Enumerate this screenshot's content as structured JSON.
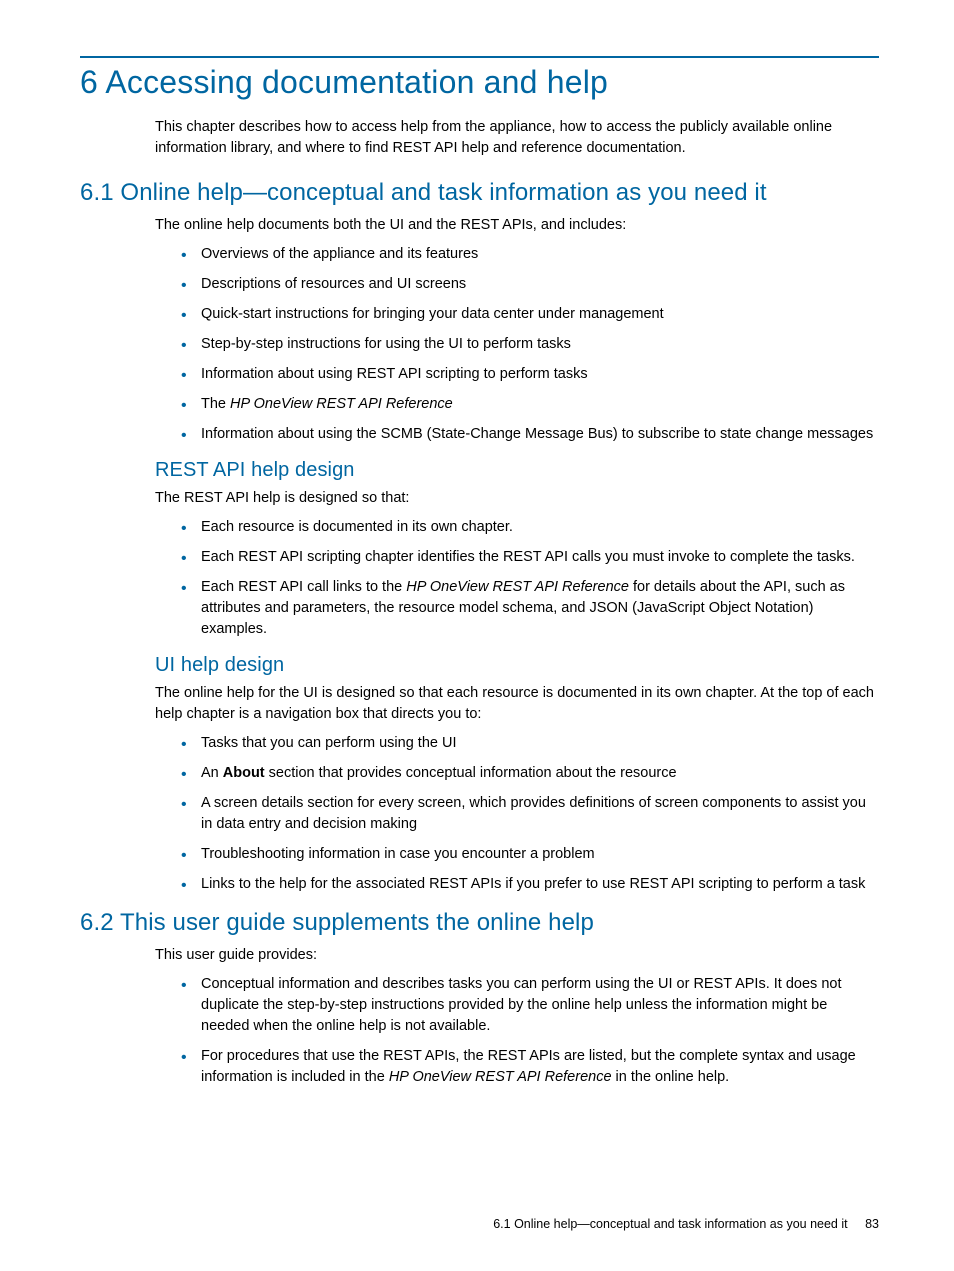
{
  "chapter": {
    "title": "6 Accessing documentation and help",
    "intro": "This chapter describes how to access help from the appliance, how to access the publicly available online information library, and where to find REST API help and reference documentation."
  },
  "section61": {
    "title": "6.1 Online help—conceptual and task information as you need it",
    "intro": "The online help documents both the UI and the REST APIs, and includes:",
    "bullets": [
      "Overviews of the appliance and its features",
      "Descriptions of resources and UI screens",
      "Quick-start instructions for bringing your data center under management",
      "Step-by-step instructions for using the UI to perform tasks",
      "Information about using REST API scripting to perform tasks"
    ],
    "bullet_the": "The ",
    "bullet_ref": "HP OneView REST API Reference",
    "bullet_scmb": "Information about using the SCMB (State-Change Message Bus) to subscribe to state change messages"
  },
  "rest_design": {
    "title": "REST API help design",
    "intro": "The REST API help is designed so that:",
    "bullets": [
      "Each resource is documented in its own chapter.",
      "Each REST API scripting chapter identifies the REST API calls you must invoke to complete the tasks."
    ],
    "bullet3_a": "Each REST API call links to the ",
    "bullet3_ref": "HP OneView REST API Reference",
    "bullet3_b": " for details about the API, such as attributes and parameters, the resource model schema, and JSON (JavaScript Object Notation) examples."
  },
  "ui_design": {
    "title": "UI help design",
    "intro": "The online help for the UI is designed so that each resource is documented in its own chapter. At the top of each help chapter is a navigation box that directs you to:",
    "bullet1": "Tasks that you can perform using the UI",
    "bullet2_a": "An ",
    "bullet2_bold": "About",
    "bullet2_b": " section that provides conceptual information about the resource",
    "bullet3": "A screen details section for every screen, which provides definitions of screen components to assist you in data entry and decision making",
    "bullet4": "Troubleshooting information in case you encounter a problem",
    "bullet5": "Links to the help for the associated REST APIs if you prefer to use REST API scripting to perform a task"
  },
  "section62": {
    "title": "6.2 This user guide supplements the online help",
    "intro": "This user guide provides:",
    "bullet1": "Conceptual information and describes tasks you can perform using the UI or REST APIs. It does not duplicate the step-by-step instructions provided by the online help unless the information might be needed when the online help is not available.",
    "bullet2_a": "For procedures that use the REST APIs, the REST APIs are listed, but the complete syntax and usage information is included in the ",
    "bullet2_ref": "HP OneView REST API Reference",
    "bullet2_b": " in the online help."
  },
  "footer": {
    "text": "6.1 Online help—conceptual and task information as you need it",
    "page": "83"
  }
}
